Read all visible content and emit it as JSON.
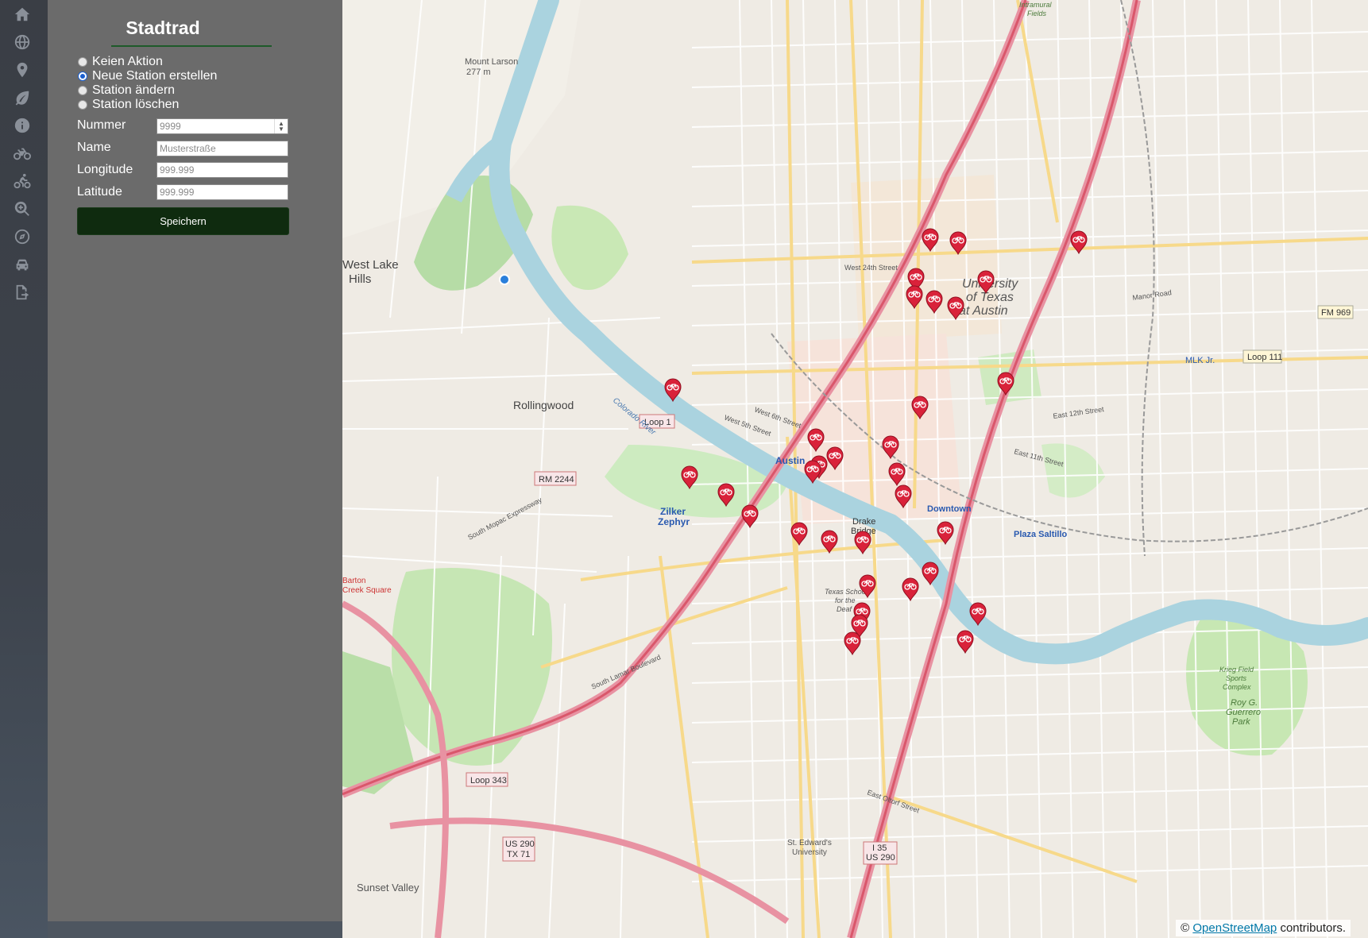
{
  "nav": {
    "icons": [
      "home-icon",
      "globe-icon",
      "map-pin-icon",
      "leaf-icon",
      "info-icon",
      "bicycle-icon",
      "cyclist-icon",
      "zoom-search-icon",
      "compass-icon",
      "car-icon",
      "export-icon"
    ]
  },
  "panel": {
    "title": "Stadtrad",
    "actions": [
      {
        "label": "Keien Aktion",
        "checked": false
      },
      {
        "label": "Neue Station erstellen",
        "checked": true
      },
      {
        "label": "Station ändern",
        "checked": false
      },
      {
        "label": "Station löschen",
        "checked": false
      }
    ],
    "fields": {
      "nummer_label": "Nummer",
      "nummer_placeholder": "9999",
      "name_label": "Name",
      "name_placeholder": "Musterstraße",
      "longitude_label": "Longitude",
      "longitude_placeholder": "999.999",
      "latitude_label": "Latitude",
      "latitude_placeholder": "999.999"
    },
    "save_label": "Speichern"
  },
  "map": {
    "attribution_prefix": "©",
    "attribution_link": "OpenStreetMap",
    "attribution_suffix": "contributors.",
    "labels": {
      "mount_larson": "Mount Larson",
      "mount_larson_elev": "277 m",
      "west_lake_hills_1": "West Lake",
      "west_lake_hills_2": "Hills",
      "rollingwood": "Rollingwood",
      "loop1": "Loop 1",
      "rm2244": "RM 2244",
      "zilker_1": "Zilker",
      "zilker_2": "Zephyr",
      "austin": "Austin",
      "university_1": "University",
      "university_2": "of Texas",
      "university_3": "at Austin",
      "downtown": "Downtown",
      "drake_1": "Drake",
      "drake_2": "Bridge",
      "plaza_saltillo": "Plaza Saltillo",
      "mlk": "MLK Jr.",
      "loop111": "Loop 111",
      "fm969": "FM 969",
      "loop343": "Loop 343",
      "us290_1": "US 290",
      "us290_2": "TX 71",
      "i35_1": "I 35",
      "i35_2": "US 290",
      "sunset_valley": "Sunset Valley",
      "st_edwards_1": "St. Edward's",
      "st_edwards_2": "University",
      "roy_g_1": "Roy G.",
      "roy_g_2": "Guerrero",
      "roy_g_3": "Park",
      "barton_1": "Barton",
      "barton_2": "Creek Square",
      "colorado_river": "Colorado River",
      "south_mopac": "South Mopac Expressway",
      "south_lamar": "South Lamar Boulevard",
      "east_oltorf": "East Oltorf Street",
      "west_24th": "West 24th Street",
      "manor_road": "Manor Road",
      "east_12th": "East 12th Street",
      "east_11th": "East 11th Street",
      "west_6th": "West 6th Street",
      "west_5th": "West 5th Street",
      "intramural_1": "Intramural",
      "intramural_2": "Fields",
      "texas_school_1": "Texas School",
      "texas_school_2": "for the",
      "texas_school_3": "Deaf",
      "krieg_1": "Krieg Field",
      "krieg_2": "Sports",
      "krieg_3": "Complex"
    },
    "stations_count_shown": 33
  }
}
